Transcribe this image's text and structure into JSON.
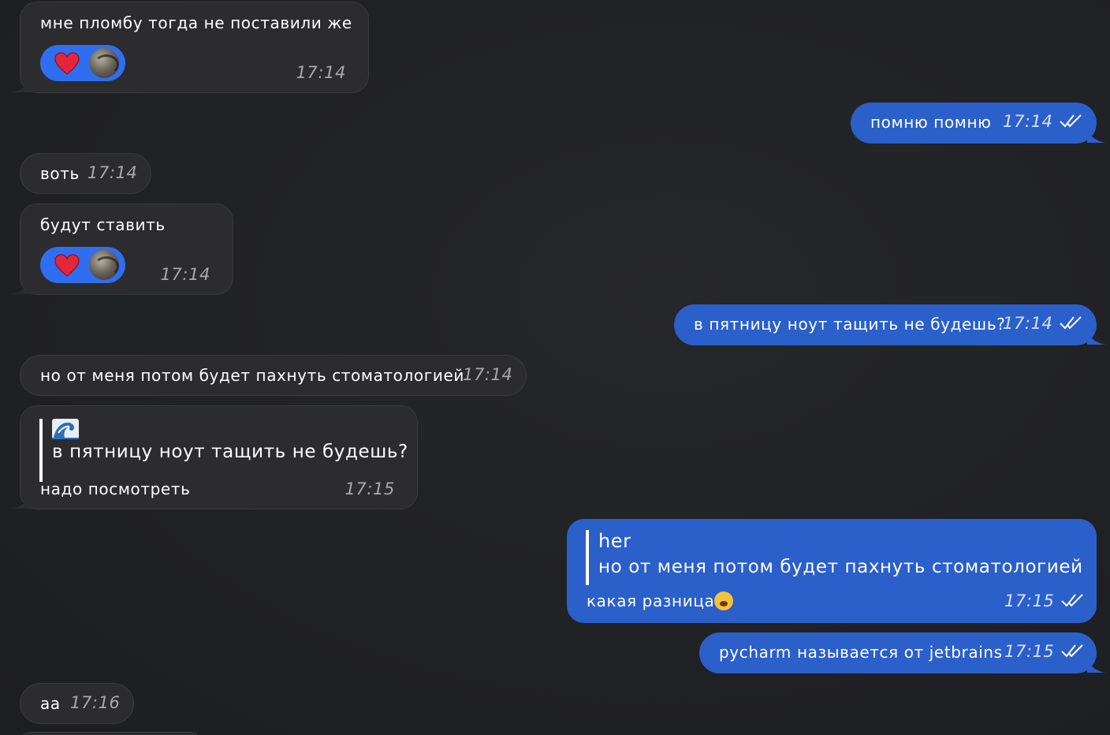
{
  "messages": {
    "m1": {
      "text": "мне пломбу тогда не поставили же",
      "time": "17:14",
      "reaction_icons": [
        "heart-emoji",
        "user-avatar"
      ]
    },
    "m2": {
      "text": "помню помню",
      "time": "17:14",
      "status": "read"
    },
    "m3": {
      "text": "воть",
      "time": "17:14"
    },
    "m4": {
      "text": "будут ставить",
      "time": "17:14",
      "reaction_icons": [
        "heart-emoji",
        "user-avatar"
      ]
    },
    "m5": {
      "text": "в пятницу ноут тащить не будешь?",
      "time": "17:14",
      "status": "read"
    },
    "m6": {
      "text": "но от меня потом будет пахнуть стоматологией",
      "time": "17:14"
    },
    "m7": {
      "reply_sender_icon": "wave-emoji",
      "reply_text": "в пятницу ноут тащить не будешь?",
      "text": "надо посмотреть",
      "time": "17:15"
    },
    "m8": {
      "reply_sender": "her",
      "reply_text": "но от меня потом будет пахнуть стоматологией",
      "text": "какая разница",
      "emoji": "loudly-crying-face",
      "time": "17:15",
      "status": "read"
    },
    "m9": {
      "text": "pycharm называется от jetbrains",
      "time": "17:15",
      "status": "read"
    },
    "m10": {
      "text": "аа",
      "time": "17:16"
    }
  },
  "colors": {
    "background": "#212225",
    "incoming_bubble": "#2c2c2e",
    "outgoing_bubble": "#2b5fc9",
    "reaction_pill": "#2f6ef0",
    "time_incoming": "#a9a9ad",
    "time_outgoing": "#d6e2ff"
  }
}
